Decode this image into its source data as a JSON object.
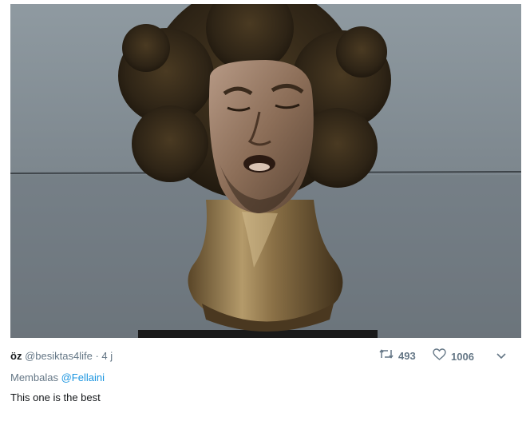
{
  "tweet": {
    "display_name": "öz",
    "handle": "@besiktas4life",
    "separator": "·",
    "time": "4 j",
    "retweet_count": "493",
    "like_count": "1006",
    "reply_prefix": "Membalas",
    "reply_to": "@Fellaini",
    "text": "This one is the best"
  },
  "icons": {
    "retweet": "retweet-icon",
    "like": "heart-icon",
    "more": "chevron-down-icon"
  },
  "colors": {
    "text": "#14171a",
    "muted": "#657786",
    "link": "#1b95e0"
  }
}
